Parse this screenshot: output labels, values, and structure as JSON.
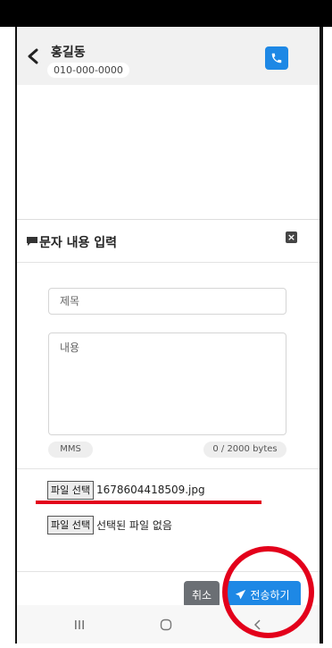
{
  "header": {
    "contact_name": "홍길동",
    "contact_phone": "010-000-0000",
    "back_icon": "chevron-left-icon",
    "call_icon": "phone-icon"
  },
  "modal": {
    "title": "문자 내용 입력",
    "title_icon": "message-icon",
    "close_icon": "close-icon",
    "subject": {
      "value": "",
      "placeholder": "제목"
    },
    "body": {
      "value": "",
      "placeholder": "내용"
    },
    "message_type": "MMS",
    "byte_counter": "0 / 2000 bytes",
    "attachments": [
      {
        "button_label": "파일 선택",
        "file_name": "1678604418509.jpg"
      },
      {
        "button_label": "파일 선택",
        "file_name": "선택된 파일 없음"
      }
    ],
    "cancel_label": "취소",
    "send_label": "전송하기",
    "send_icon": "paper-plane-icon"
  },
  "navbar": {
    "recent_icon": "recent-apps-icon",
    "home_icon": "home-icon",
    "back_icon": "back-icon"
  },
  "colors": {
    "accent": "#1e88e5",
    "cancel": "#6b6f74",
    "highlight": "#e3001b"
  }
}
